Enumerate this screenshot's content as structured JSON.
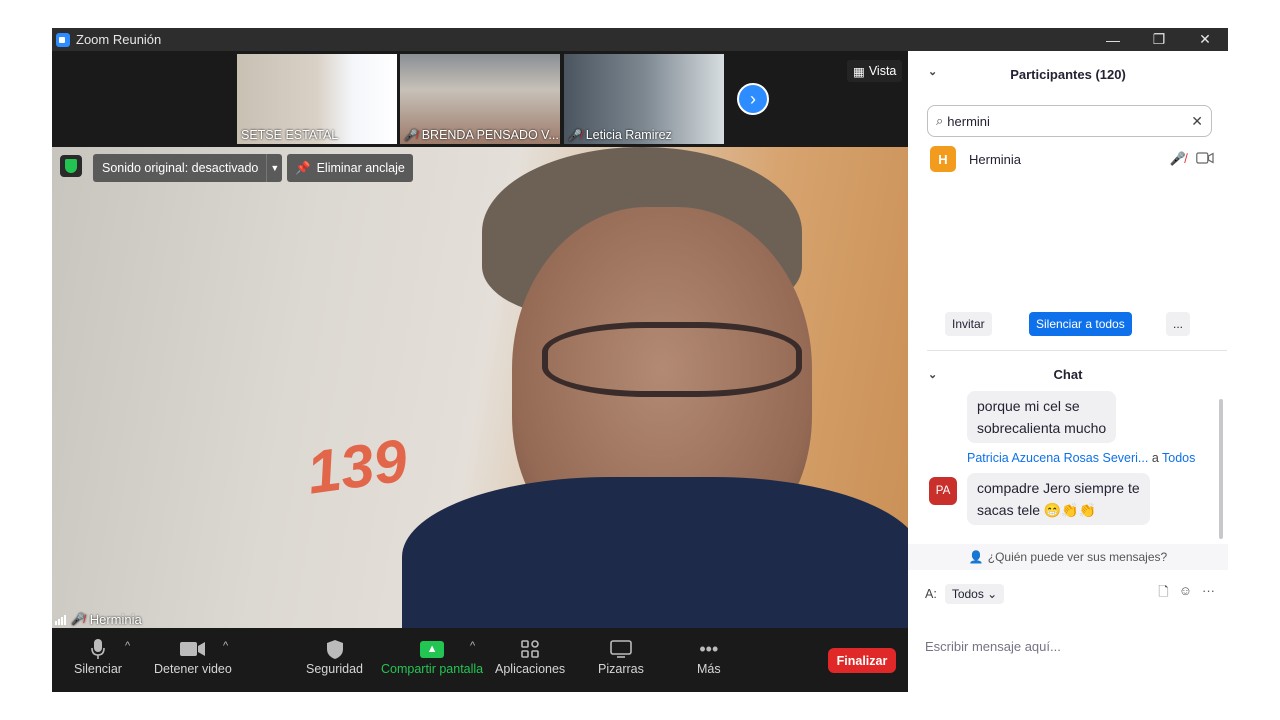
{
  "window": {
    "title": "Zoom Reunión",
    "controls": [
      "—",
      "❐",
      "✕"
    ]
  },
  "thumbnails": [
    {
      "name": "SETSE ESTATAL",
      "muted": false
    },
    {
      "name": "BRENDA PENSADO V...",
      "muted": true
    },
    {
      "name": "Leticia Ramirez",
      "muted": true
    }
  ],
  "view_label": "Vista",
  "speaker": {
    "name": "Herminia",
    "sound_original": "Sonido original: desactivado",
    "unpin_label": "Eliminar anclaje",
    "decor_text": "139"
  },
  "toolbar": {
    "mute": "Silenciar",
    "video": "Detener video",
    "security": "Seguridad",
    "share": "Compartir pantalla",
    "apps": "Aplicaciones",
    "whiteboards": "Pizarras",
    "more": "Más",
    "end": "Finalizar"
  },
  "participants": {
    "header": "Participantes (120)",
    "search_value": "hermini",
    "list": [
      {
        "initial": "H",
        "name": "Herminia"
      }
    ],
    "buttons": {
      "invite": "Invitar",
      "mute_all": "Silenciar a todos",
      "more": "..."
    }
  },
  "chat": {
    "header": "Chat",
    "messages": [
      {
        "text_line1": "porque mi cel se",
        "text_line2": "sobrecalienta mucho"
      },
      {
        "sender": "Patricia Azucena Rosas Severi...",
        "to_prefix": "a",
        "to": "Todos",
        "initials": "PA",
        "text_line1": "compadre Jero siempre te",
        "text_line2": "sacas tele 😁👏👏"
      }
    ],
    "who_sees": "¿Quién puede ver sus mensajes?",
    "to_label": "A:",
    "to_value": "Todos",
    "input_placeholder": "Escribir mensaje aquí..."
  },
  "colors": {
    "accent": "#0e71eb",
    "end": "#e02828",
    "share": "#23c552",
    "avatar_h": "#f29b1d",
    "avatar_pa": "#c9302c"
  }
}
